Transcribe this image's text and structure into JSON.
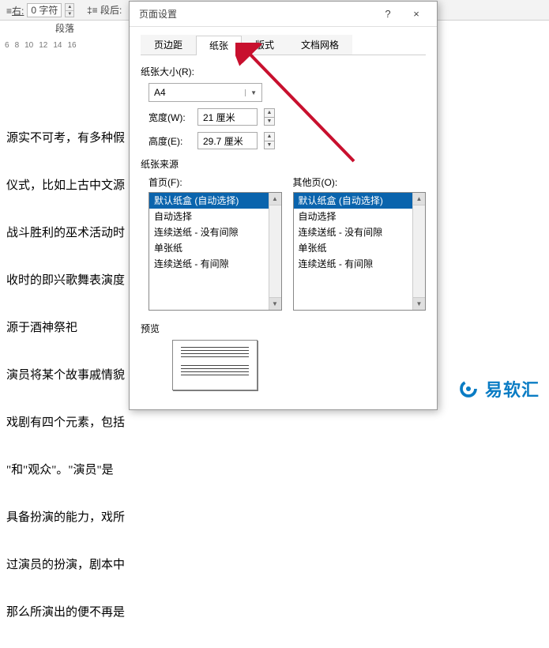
{
  "ribbon": {
    "left_label": "右:",
    "left_value": "0 字符",
    "right_label": "段后:",
    "group": "段落"
  },
  "ruler": [
    "6",
    "8",
    "10",
    "12",
    "14",
    "16"
  ],
  "document": {
    "lines": [
      "源实不可考，有多种假",
      "仪式，比如上古中文源",
      "战斗胜利的巫术活动时",
      "收时的即兴歌舞表演度",
      "源于酒神祭祀",
      "演员将某个故事戚情貌",
      "戏剧有四个元素，包括",
      "\"和\"观众\"。\"演员\"是",
      "具备扮演的能力，戏所",
      "过演员的扮演，剧本中",
      "那么所演出的便不再是"
    ]
  },
  "dialog": {
    "title": "页面设置",
    "help": "?",
    "close": "×",
    "tabs": [
      "页边距",
      "纸张",
      "版式",
      "文档网格"
    ],
    "active_tab": 1,
    "paper_size": {
      "label": "纸张大小(R):",
      "value": "A4",
      "width_label": "宽度(W):",
      "width_value": "21 厘米",
      "height_label": "高度(E):",
      "height_value": "29.7 厘米"
    },
    "paper_source": {
      "legend": "纸张来源",
      "first_label": "首页(F):",
      "other_label": "其他页(O):",
      "options": [
        "默认纸盒 (自动选择)",
        "自动选择",
        "连续送纸 - 没有间隙",
        "单张纸",
        "连续送纸 - 有间隙"
      ]
    },
    "preview_label": "预览"
  },
  "watermark": "易软汇"
}
